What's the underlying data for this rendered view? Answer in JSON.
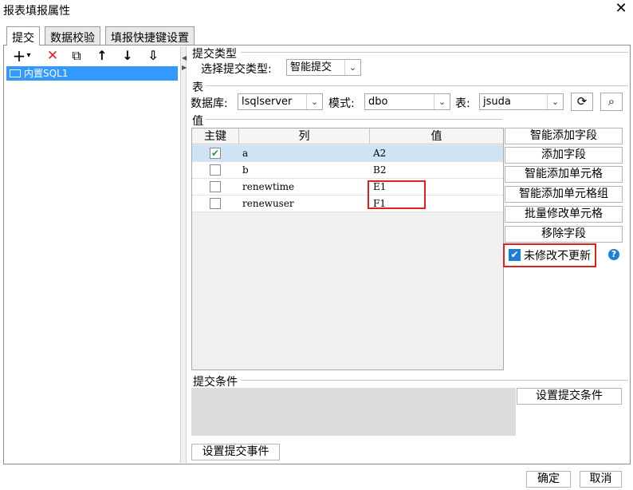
{
  "window": {
    "title": "报表填报属性",
    "close_glyph": "✕"
  },
  "tabs": [
    {
      "label": "提交",
      "active": true
    },
    {
      "label": "数据校验",
      "active": false
    },
    {
      "label": "填报快捷键设置",
      "active": false
    }
  ],
  "toolbar": {
    "add": "+",
    "add_dropdown": "▾",
    "delete": "✕",
    "copy": "⧉",
    "up": "↑",
    "down": "↓",
    "sort": "⇩"
  },
  "tree": {
    "items": [
      {
        "label": "内置SQL1"
      }
    ]
  },
  "submit_type": {
    "section": "提交类型",
    "label": "选择提交类型:",
    "value": "智能提交"
  },
  "table": {
    "section": "表",
    "db_label": "数据库:",
    "db_value": "lsqlserver",
    "schema_label": "模式:",
    "schema_value": "dbo",
    "table_label": "表:",
    "table_value": "jsuda"
  },
  "values": {
    "section": "值",
    "headers": {
      "pk": "主键",
      "col": "列",
      "val": "值"
    },
    "rows": [
      {
        "checked": true,
        "col": "a",
        "val": "A2"
      },
      {
        "checked": false,
        "col": "b",
        "val": "B2"
      },
      {
        "checked": false,
        "col": "renewtime",
        "val": "E1"
      },
      {
        "checked": false,
        "col": "renewuser",
        "val": "F1"
      }
    ]
  },
  "side_buttons": {
    "smart_add_field": "智能添加字段",
    "add_field": "添加字段",
    "smart_add_cell": "智能添加单元格",
    "smart_add_cell_group": "智能添加单元格组",
    "batch_modify_cell": "批量修改单元格",
    "remove_field": "移除字段"
  },
  "no_update_unmodified": {
    "label": "未修改不更新",
    "checked": true
  },
  "condition": {
    "section": "提交条件",
    "set_button": "设置提交条件"
  },
  "event_button": "设置提交事件",
  "footer": {
    "ok": "确定",
    "cancel": "取消"
  },
  "colors": {
    "selection": "#3399ff",
    "highlight": "#e02020",
    "check_blue": "#1e7fd8",
    "check_green": "#1f9a3a"
  }
}
